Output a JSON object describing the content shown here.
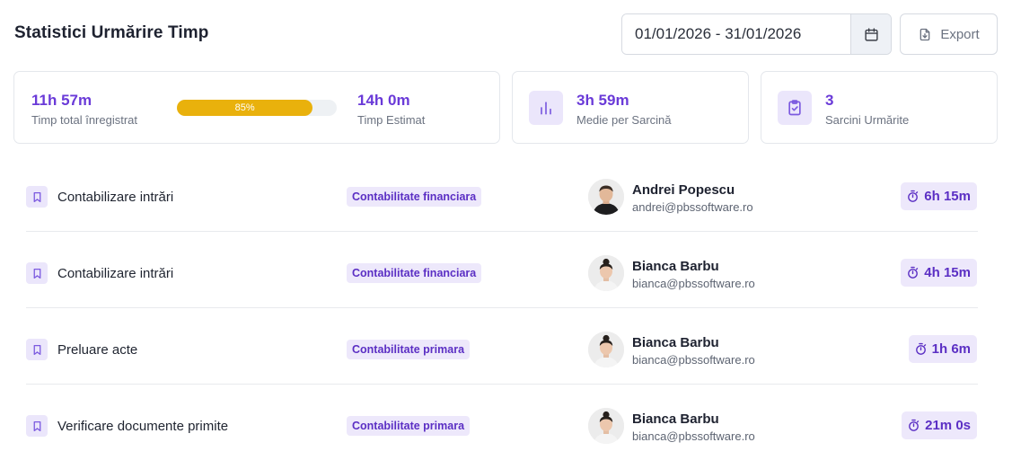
{
  "header": {
    "title": "Statistici Urmărire Timp",
    "date_range": "01/01/2026 - 31/01/2026",
    "export_label": "Export"
  },
  "stats": {
    "total": {
      "value": "11h 57m",
      "label": "Timp total înregistrat",
      "progress_percent": 85,
      "progress_label": "85%",
      "estimate_value": "14h 0m",
      "estimate_label": "Timp Estimat"
    },
    "average": {
      "value": "3h 59m",
      "label": "Medie per Sarcină",
      "icon": "bar-chart-icon"
    },
    "tracked": {
      "value": "3",
      "label": "Sarcini Urmărite",
      "icon": "clipboard-check-icon"
    }
  },
  "tasks": [
    {
      "name": "Contabilizare intrări",
      "category": "Contabilitate financiara",
      "user_name": "Andrei Popescu",
      "user_email": "andrei@pbssoftware.ro",
      "avatar": "male-avatar",
      "duration": "6h 15m"
    },
    {
      "name": "Contabilizare intrări",
      "category": "Contabilitate financiara",
      "user_name": "Bianca Barbu",
      "user_email": "bianca@pbssoftware.ro",
      "avatar": "female-avatar",
      "duration": "4h 15m"
    },
    {
      "name": "Preluare acte",
      "category": "Contabilitate primara",
      "user_name": "Bianca Barbu",
      "user_email": "bianca@pbssoftware.ro",
      "avatar": "female-avatar",
      "duration": "1h 6m"
    },
    {
      "name": "Verificare documente primite",
      "category": "Contabilitate primara",
      "user_name": "Bianca Barbu",
      "user_email": "bianca@pbssoftware.ro",
      "avatar": "female-avatar",
      "duration": "21m 0s"
    }
  ],
  "colors": {
    "accent": "#6a3ad8",
    "progress": "#e9b10c",
    "tag_bg": "#ede8fb"
  }
}
